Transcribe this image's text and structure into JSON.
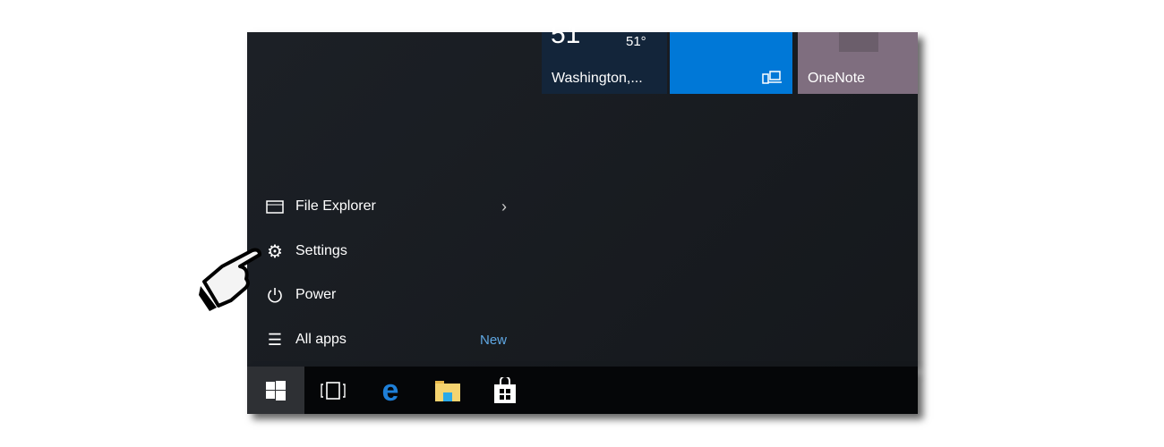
{
  "tiles": [
    {
      "name": "weather",
      "temp_big": "51",
      "temp_small": "51°",
      "label": "Washington,...",
      "color": "#13253a"
    },
    {
      "name": "phone-companion",
      "label": "",
      "color": "#0078d7"
    },
    {
      "name": "onenote",
      "label": "OneNote",
      "color": "#7f6e7f"
    }
  ],
  "menu": {
    "file_explorer": "File Explorer",
    "settings": "Settings",
    "power": "Power",
    "all_apps": "All apps",
    "new_badge": "New"
  }
}
